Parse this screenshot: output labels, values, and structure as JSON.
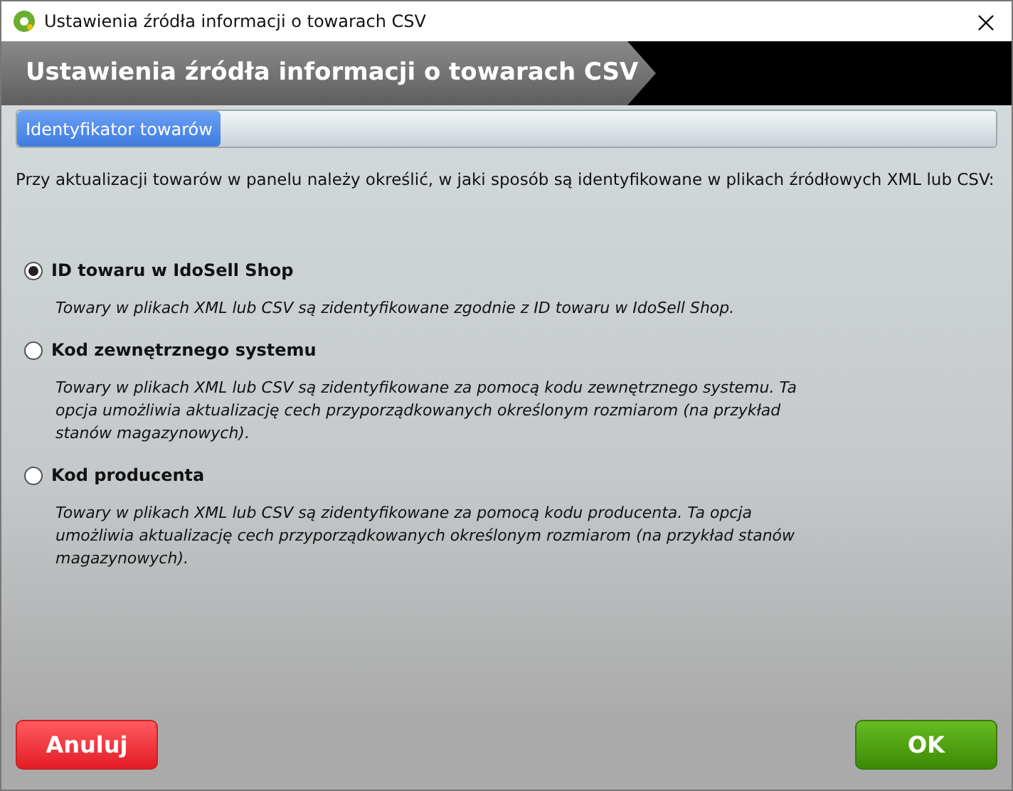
{
  "window": {
    "title": "Ustawienia źródła informacji o towarach CSV"
  },
  "header": {
    "title": "Ustawienia źródła informacji o towarach CSV"
  },
  "tabs": [
    {
      "label": "Identyfikator towarów",
      "selected": true
    }
  ],
  "intro": "Przy aktualizacji towarów w panelu należy określić, w jaki sposób są identyfikowane w plikach źródłowych XML lub CSV:",
  "options": [
    {
      "label": "ID towaru w IdoSell Shop",
      "selected": true,
      "description": "Towary w plikach XML lub CSV są zidentyfikowane zgodnie z ID towaru w IdoSell Shop."
    },
    {
      "label": "Kod zewnętrznego systemu",
      "selected": false,
      "description": "Towary w plikach XML lub CSV są zidentyfikowane za pomocą kodu zewnętrznego systemu. Ta opcja umożliwia aktualizację cech przyporządkowanych określonym rozmiarom (na przykład stanów magazynowych)."
    },
    {
      "label": "Kod producenta",
      "selected": false,
      "description": "Towary w plikach XML lub CSV są zidentyfikowane za pomocą kodu producenta. Ta opcja umożliwia aktualizację cech przyporządkowanych określonym rozmiarom (na przykład stanów magazynowych)."
    }
  ],
  "buttons": [
    {
      "label": "Anuluj",
      "kind": "cancel"
    },
    {
      "label": "OK",
      "kind": "ok"
    }
  ]
}
